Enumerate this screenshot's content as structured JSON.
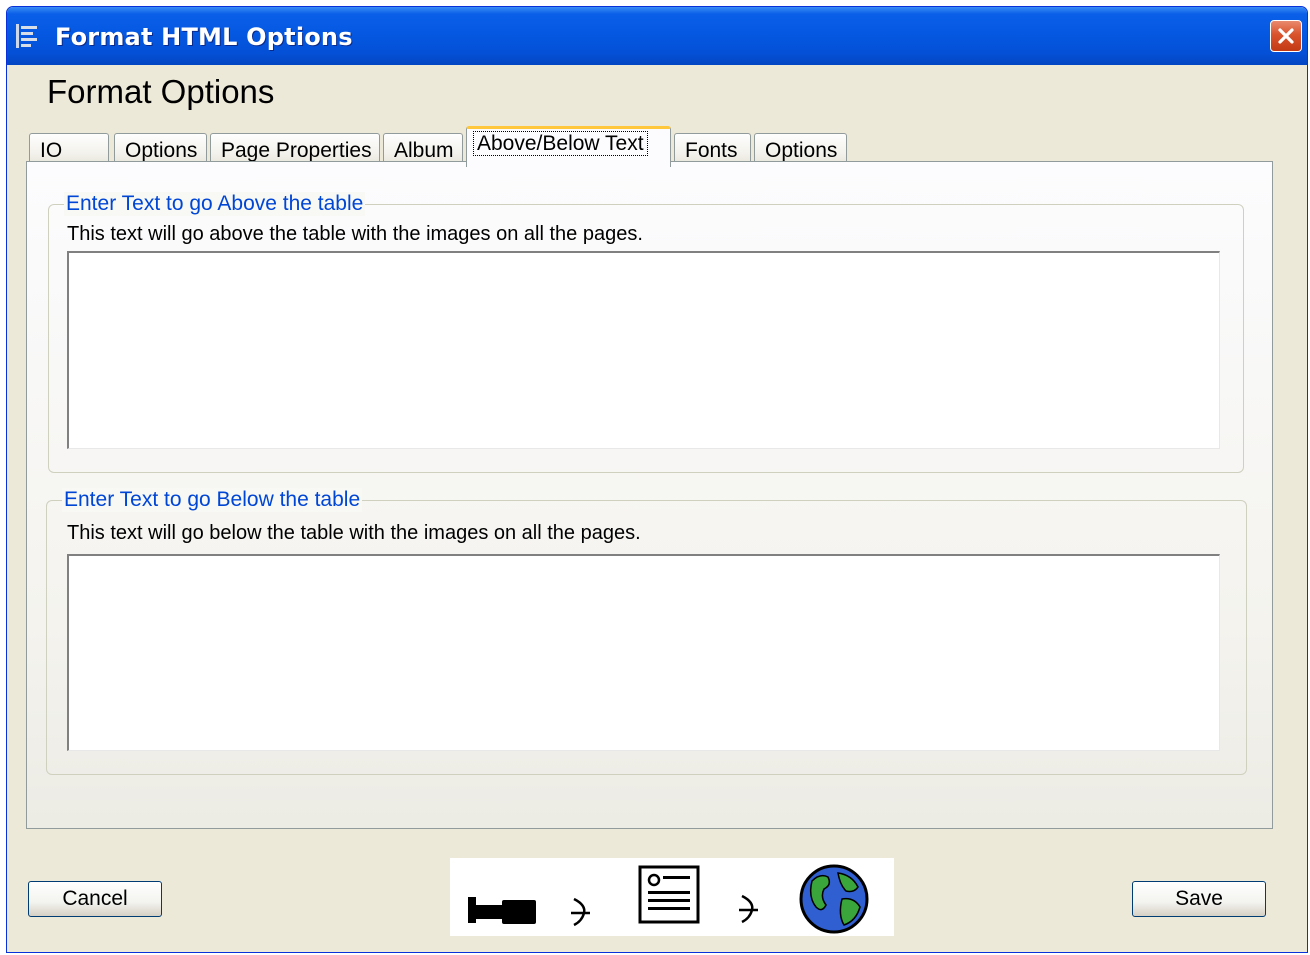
{
  "window": {
    "title": "Format HTML Options",
    "close_icon": "close-icon"
  },
  "heading": "Format Options",
  "tabs": [
    {
      "label": "IO"
    },
    {
      "label": "Options"
    },
    {
      "label": "Page Properties"
    },
    {
      "label": "Album"
    },
    {
      "label": "Above/Below Text",
      "selected": true
    },
    {
      "label": "Fonts"
    },
    {
      "label": "Options"
    }
  ],
  "above_group": {
    "legend": "Enter Text to go Above the table",
    "description": "This text will go above the table with the images on all the pages.",
    "value": ""
  },
  "below_group": {
    "legend": "Enter Text to go Below the table",
    "description": "This text will go below the table with the images on all the pages.",
    "value": ""
  },
  "buttons": {
    "cancel": "Cancel",
    "save": "Save"
  },
  "banner_icons": [
    "camera-icon",
    "arrow-icon",
    "document-icon",
    "arrow-icon",
    "globe-icon"
  ],
  "colors": {
    "titlebar": "#0558e2",
    "legend_text": "#0046d5",
    "dialog_bg": "#ece9d8",
    "active_tab_highlight": "#ffc83c",
    "close_button": "#d9532c"
  }
}
